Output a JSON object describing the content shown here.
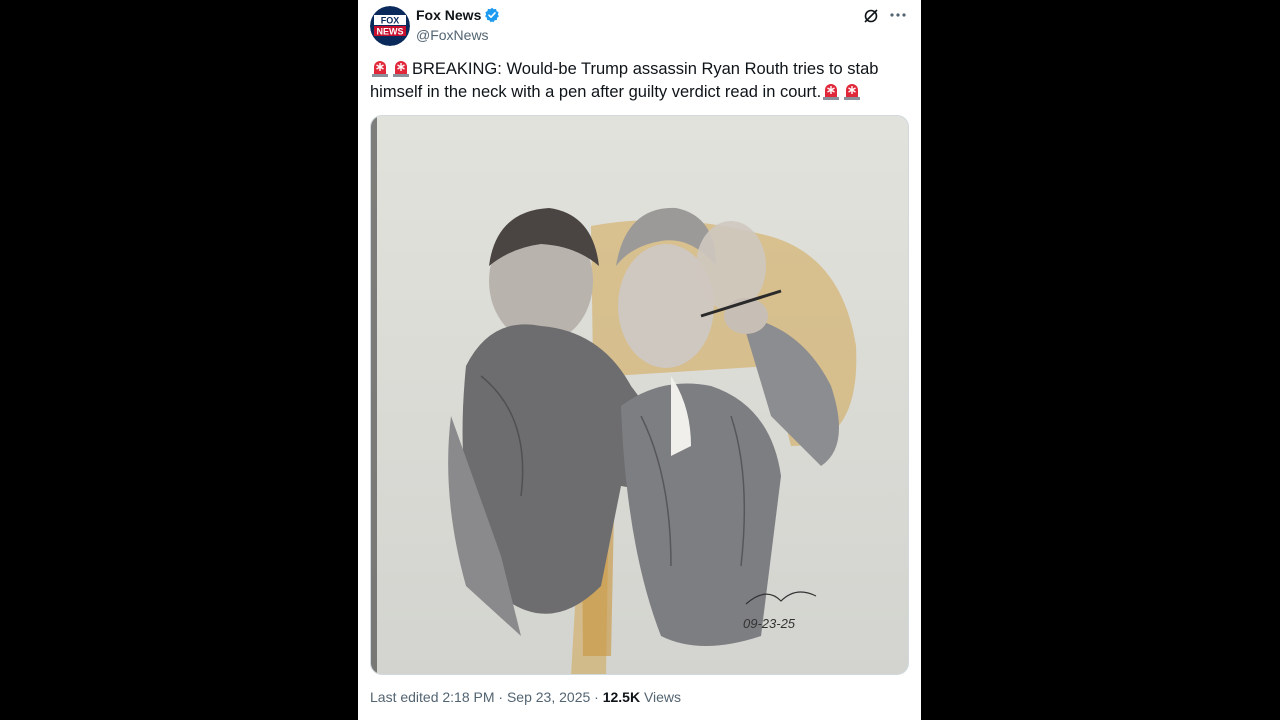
{
  "account": {
    "name": "Fox News",
    "handle": "@FoxNews",
    "avatar_text": [
      "FOX",
      "NEWS"
    ],
    "verified_color": "#1d9bf0"
  },
  "post": {
    "text_main": "BREAKING: Would-be Trump assassin Ryan Routh tries to stab himself in the neck with a pen after guilty verdict read in court.",
    "emoji": "siren-icon"
  },
  "media": {
    "type": "courtroom sketch",
    "signature_text": "09-23-25"
  },
  "meta": {
    "last_edited": "Last edited 2:18 PM · Sep 23, 2025 · ",
    "views_count": "12.5K",
    "views_label": " Views"
  },
  "colors": {
    "background": "#000000",
    "card": "#ffffff",
    "text": "#0f1419",
    "secondary": "#536471",
    "accent": "#1d9bf0"
  }
}
